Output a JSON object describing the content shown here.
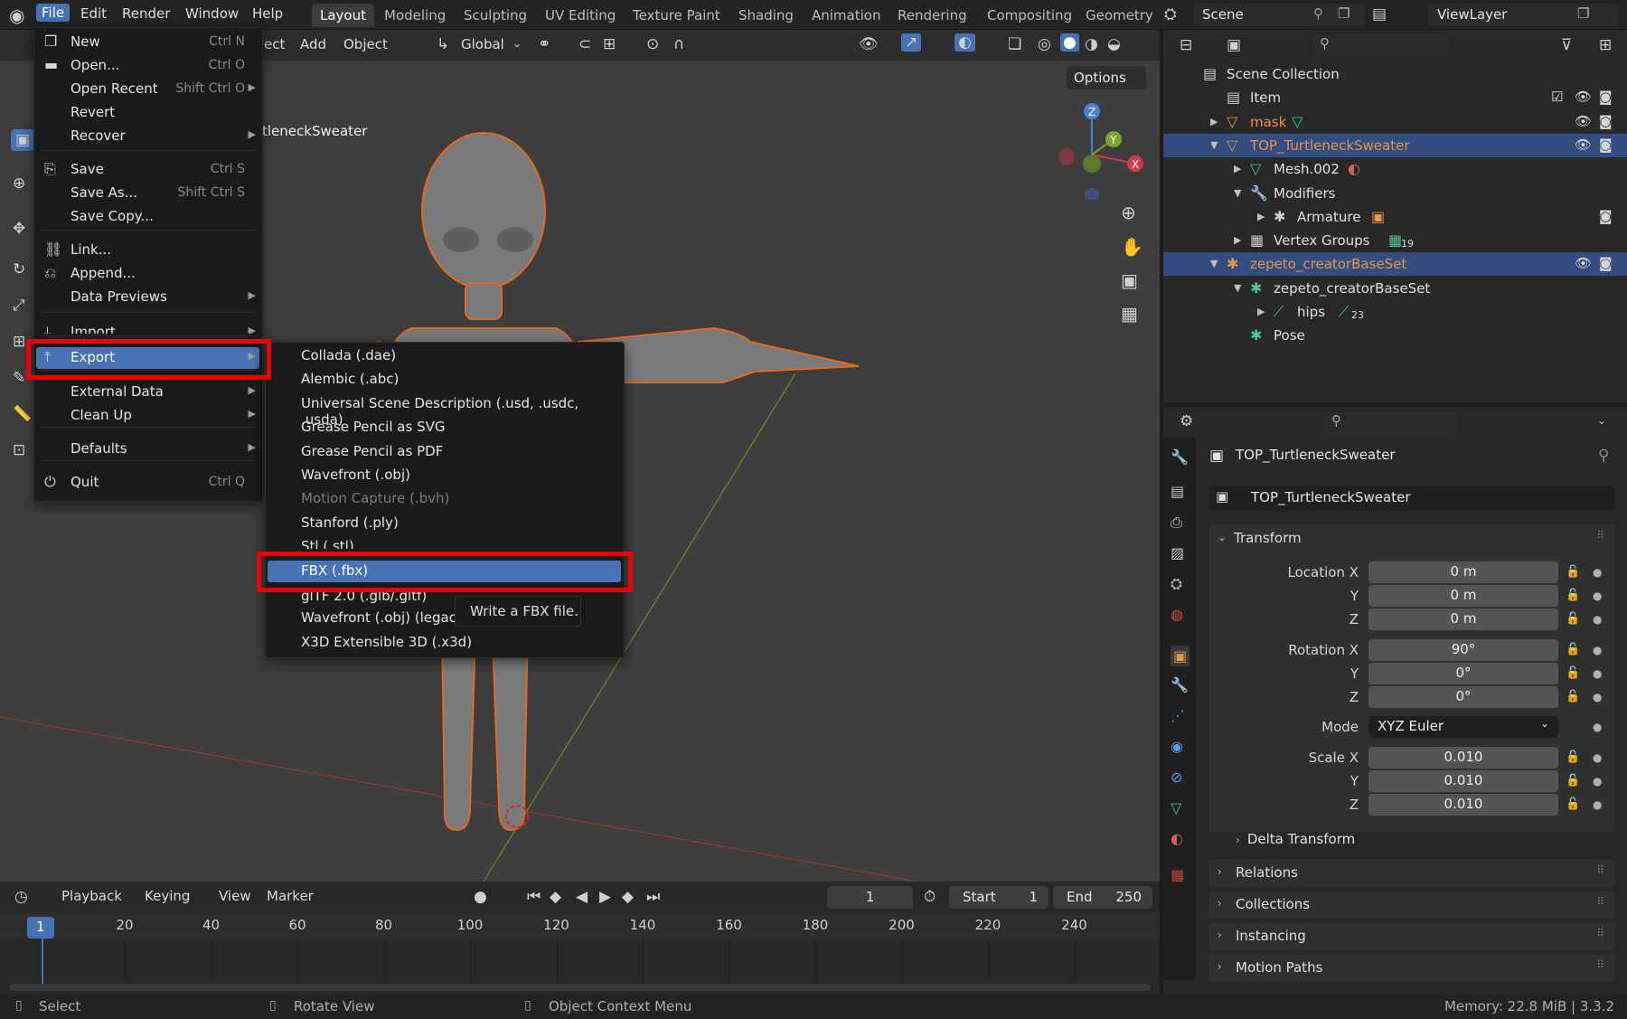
{
  "topbar": {
    "menus": [
      "File",
      "Edit",
      "Render",
      "Window",
      "Help"
    ],
    "workspaces": [
      "Layout",
      "Modeling",
      "Sculpting",
      "UV Editing",
      "Texture Paint",
      "Shading",
      "Animation",
      "Rendering",
      "Compositing",
      "Geometry"
    ],
    "scene": "Scene",
    "view_layer": "ViewLayer"
  },
  "viewport": {
    "header_items": [
      "ect",
      "Add",
      "Object"
    ],
    "orientation": "Global",
    "options": "Options",
    "object_label": "tleneckSweater"
  },
  "file_menu": {
    "items": [
      {
        "label": "New",
        "shortcut": "Ctrl N",
        "icon": "new-file-icon"
      },
      {
        "label": "Open...",
        "shortcut": "Ctrl O",
        "icon": "folder-icon"
      },
      {
        "label": "Open Recent",
        "shortcut": "Shift Ctrl O",
        "icon": ""
      },
      {
        "label": "Revert",
        "shortcut": "",
        "icon": ""
      },
      {
        "label": "Recover",
        "shortcut": "",
        "icon": ""
      },
      {
        "label": "Save",
        "shortcut": "Ctrl S",
        "icon": "save-icon"
      },
      {
        "label": "Save As...",
        "shortcut": "Shift Ctrl S",
        "icon": ""
      },
      {
        "label": "Save Copy...",
        "shortcut": "",
        "icon": ""
      },
      {
        "label": "Link...",
        "shortcut": "",
        "icon": "link-icon"
      },
      {
        "label": "Append...",
        "shortcut": "",
        "icon": "append-icon"
      },
      {
        "label": "Data Previews",
        "shortcut": "",
        "icon": ""
      },
      {
        "label": "Import",
        "shortcut": "",
        "icon": "import-icon"
      },
      {
        "label": "Export",
        "shortcut": "",
        "icon": "export-icon"
      },
      {
        "label": "External Data",
        "shortcut": "",
        "icon": ""
      },
      {
        "label": "Clean Up",
        "shortcut": "",
        "icon": ""
      },
      {
        "label": "Defaults",
        "shortcut": "",
        "icon": ""
      },
      {
        "label": "Quit",
        "shortcut": "Ctrl Q",
        "icon": "quit-icon"
      }
    ]
  },
  "export_menu": {
    "items": [
      "Collada (.dae)",
      "Alembic (.abc)",
      "Universal Scene Description (.usd, .usdc, .usda)",
      "Grease Pencil as SVG",
      "Grease Pencil as PDF",
      "Wavefront (.obj)",
      "Motion Capture (.bvh)",
      "Stanford (.ply)",
      "Stl (.stl)",
      "FBX (.fbx)",
      "glTF 2.0 (.glb/.gltf)",
      "Wavefront (.obj) (legacy)",
      "X3D Extensible 3D (.x3d)"
    ],
    "tooltip": "Write a FBX file."
  },
  "outliner": {
    "rows": [
      {
        "label": "Scene Collection"
      },
      {
        "label": "Item"
      },
      {
        "label": "mask"
      },
      {
        "label": "TOP_TurtleneckSweater"
      },
      {
        "label": "Mesh.002"
      },
      {
        "label": "Modifiers"
      },
      {
        "label": "Armature"
      },
      {
        "label": "Vertex Groups",
        "badge": "19"
      },
      {
        "label": "zepeto_creatorBaseSet"
      },
      {
        "label": "zepeto_creatorBaseSet"
      },
      {
        "label": "hips",
        "badge": "23"
      },
      {
        "label": "Pose"
      }
    ]
  },
  "properties": {
    "object_name": "TOP_TurtleneckSweater",
    "data_name": "TOP_TurtleneckSweater",
    "transform_label": "Transform",
    "rows": [
      {
        "label": "Location X",
        "value": "0 m"
      },
      {
        "label": "Y",
        "value": "0 m"
      },
      {
        "label": "Z",
        "value": "0 m"
      },
      {
        "label": "Rotation X",
        "value": "90°"
      },
      {
        "label": "Y",
        "value": "0°"
      },
      {
        "label": "Z",
        "value": "0°"
      },
      {
        "label": "Mode",
        "value": "XYZ Euler"
      },
      {
        "label": "Scale X",
        "value": "0.010"
      },
      {
        "label": "Y",
        "value": "0.010"
      },
      {
        "label": "Z",
        "value": "0.010"
      }
    ],
    "delta": "Delta Transform",
    "sections": [
      "Relations",
      "Collections",
      "Instancing",
      "Motion Paths"
    ]
  },
  "timeline": {
    "menus": [
      "Playback",
      "Keying",
      "View",
      "Marker"
    ],
    "current_frame": "1",
    "start_label": "Start",
    "start": "1",
    "end_label": "End",
    "end": "250",
    "ticks": [
      "1",
      "20",
      "40",
      "60",
      "80",
      "100",
      "120",
      "140",
      "160",
      "180",
      "200",
      "220",
      "240"
    ]
  },
  "statusbar": {
    "select": "Select",
    "rotate": "Rotate View",
    "context": "Object Context Menu",
    "memory": "Memory: 22.8 MiB | 3.3.2"
  }
}
